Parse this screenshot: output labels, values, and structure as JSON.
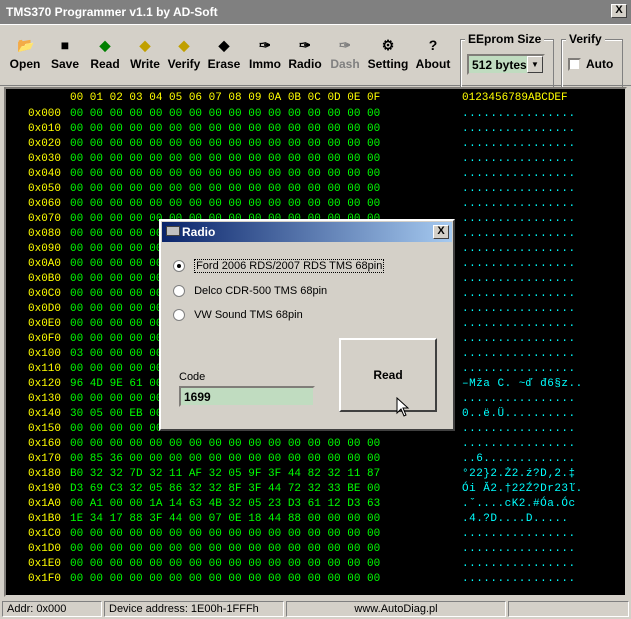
{
  "window": {
    "title": "TMS370 Programmer v1.1  by AD-Soft",
    "close_label": "X"
  },
  "toolbar": {
    "open": "Open",
    "save": "Save",
    "read": "Read",
    "write": "Write",
    "verify": "Verify",
    "erase": "Erase",
    "immo": "Immo",
    "radio": "Radio",
    "dash": "Dash",
    "setting": "Setting",
    "about": "About"
  },
  "eeprom": {
    "legend": "EEprom Size",
    "value": "512 bytes"
  },
  "verify_group": {
    "legend": "Verify",
    "auto_label": "Auto"
  },
  "hex": {
    "header_bytes": "00 01 02 03 04 05 06 07 08 09 0A 0B 0C 0D 0E 0F",
    "header_ascii": "0123456789ABCDEF",
    "rows": [
      {
        "addr": "0x000",
        "bytes": "00 00 00 00 00 00 00 00 00 00 00 00 00 00 00 00",
        "ascii": "................"
      },
      {
        "addr": "0x010",
        "bytes": "00 00 00 00 00 00 00 00 00 00 00 00 00 00 00 00",
        "ascii": "................"
      },
      {
        "addr": "0x020",
        "bytes": "00 00 00 00 00 00 00 00 00 00 00 00 00 00 00 00",
        "ascii": "................"
      },
      {
        "addr": "0x030",
        "bytes": "00 00 00 00 00 00 00 00 00 00 00 00 00 00 00 00",
        "ascii": "................"
      },
      {
        "addr": "0x040",
        "bytes": "00 00 00 00 00 00 00 00 00 00 00 00 00 00 00 00",
        "ascii": "................"
      },
      {
        "addr": "0x050",
        "bytes": "00 00 00 00 00 00 00 00 00 00 00 00 00 00 00 00",
        "ascii": "................"
      },
      {
        "addr": "0x060",
        "bytes": "00 00 00 00 00 00 00 00 00 00 00 00 00 00 00 00",
        "ascii": "................"
      },
      {
        "addr": "0x070",
        "bytes": "00 00 00 00 00 00 00 00 00 00 00 00 00 00 00 00",
        "ascii": "................"
      },
      {
        "addr": "0x080",
        "bytes": "00 00 00 00 00 00 00 00 00 00 00 00 00 00 00 00",
        "ascii": "................"
      },
      {
        "addr": "0x090",
        "bytes": "00 00 00 00 00 00 00 00 00 00 00 00 00 00 00 00",
        "ascii": "................"
      },
      {
        "addr": "0x0A0",
        "bytes": "00 00 00 00 00 00 00 00 00 00 00 00 00 00 00 00",
        "ascii": "................"
      },
      {
        "addr": "0x0B0",
        "bytes": "00 00 00 00 00 00 00 00 00 00 00 00 00 00 00 00",
        "ascii": "................"
      },
      {
        "addr": "0x0C0",
        "bytes": "00 00 00 00 00 00 00 00 00 00 00 00 00 00 00 00",
        "ascii": "................"
      },
      {
        "addr": "0x0D0",
        "bytes": "00 00 00 00 00 00 00 00 00 00 00 00 00 00 00 00",
        "ascii": "................"
      },
      {
        "addr": "0x0E0",
        "bytes": "00 00 00 00 00 00 00 00 00 00 00 00 00 00 00 00",
        "ascii": "................"
      },
      {
        "addr": "0x0F0",
        "bytes": "00 00 00 00 00 00 00 00 00 00 00 00 00 00 00 00",
        "ascii": "................"
      },
      {
        "addr": "0x100",
        "bytes": "03 00 00 00 00 00 00 00 00 00 00 00 00 00 00 00",
        "ascii": "................"
      },
      {
        "addr": "0x110",
        "bytes": "00 00 00 00 00 00 00 00 00 00 00 00 00 00 00 00",
        "ascii": "................"
      },
      {
        "addr": "0x120",
        "bytes": "96 4D 9E 61 00 00 00 00 00 00 00 00 00 00 00 00",
        "ascii": "–Mža C. ~ď đ6§z.."
      },
      {
        "addr": "0x130",
        "bytes": "00 00 00 00 00 00 00 00 00 00 00 00 00 00 00 00",
        "ascii": "................"
      },
      {
        "addr": "0x140",
        "bytes": "30 05 00 EB 00 00 00 00 00 00 00 00 00 00 00 00",
        "ascii": "0..ë.Ü.........."
      },
      {
        "addr": "0x150",
        "bytes": "00 00 00 00 00 00 00 00 00 00 00 00 00 00 00 00",
        "ascii": "................"
      },
      {
        "addr": "0x160",
        "bytes": "00 00 00 00 00 00 00 00 00 00 00 00 00 00 00 00",
        "ascii": "................"
      },
      {
        "addr": "0x170",
        "bytes": "00 85 36 00 00 00 00 00 00 00 00 00 00 00 00 00",
        "ascii": "..6............."
      },
      {
        "addr": "0x180",
        "bytes": "B0 32 32 7D 32 11 AF 32 05 9F 3F 44 82 32 11 87",
        "ascii": "°22}2.Ż2.ź?D‚2.‡"
      },
      {
        "addr": "0x190",
        "bytes": "D3 69 C3 32 05 86 32 32 8F 3F 44 72 32 33 BE 00",
        "ascii": "Ói Ă2.†22Ź?Dr23ľ."
      },
      {
        "addr": "0x1A0",
        "bytes": "00 A1 00 00 1A 14 63 4B 32 05 23 D3 61 12 D3 63",
        "ascii": ".ˇ....cK2.#Óa.Óc"
      },
      {
        "addr": "0x1B0",
        "bytes": "1E 34 17 88 3F 44 00 07 0E 18 44 88 00 00 00 00",
        "ascii": ".4.?D....D....."
      },
      {
        "addr": "0x1C0",
        "bytes": "00 00 00 00 00 00 00 00 00 00 00 00 00 00 00 00",
        "ascii": "................"
      },
      {
        "addr": "0x1D0",
        "bytes": "00 00 00 00 00 00 00 00 00 00 00 00 00 00 00 00",
        "ascii": "................"
      },
      {
        "addr": "0x1E0",
        "bytes": "00 00 00 00 00 00 00 00 00 00 00 00 00 00 00 00",
        "ascii": "................"
      },
      {
        "addr": "0x1F0",
        "bytes": "00 00 00 00 00 00 00 00 00 00 00 00 00 00 00 00",
        "ascii": "................"
      }
    ]
  },
  "dialog": {
    "title": "Radio",
    "close_label": "X",
    "options": [
      {
        "label": "Ford 2006 RDS/2007 RDS TMS 68pin",
        "selected": true
      },
      {
        "label": "Delco CDR-500 TMS 68pin",
        "selected": false
      },
      {
        "label": "VW Sound TMS 68pin",
        "selected": false
      }
    ],
    "code_label": "Code",
    "code_value": "1699",
    "read_label": "Read"
  },
  "status": {
    "addr": "Addr: 0x000",
    "device": "Device address: 1E00h-1FFFh",
    "url": "www.AutoDiag.pl"
  },
  "colors": {
    "hex_bytes": "#00ff00",
    "hex_addr": "#ffff00",
    "hex_ascii": "#00ffff",
    "field_bg": "#c0dcc0"
  }
}
